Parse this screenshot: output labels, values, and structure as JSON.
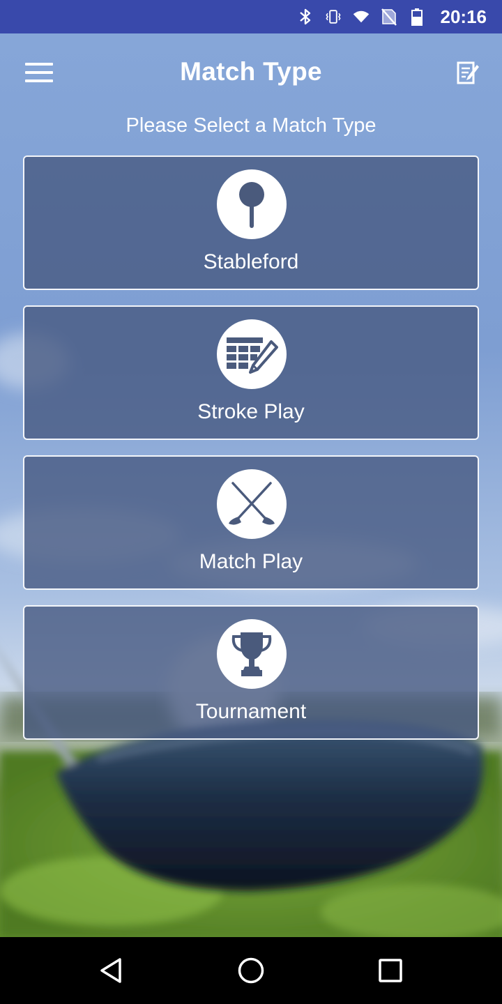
{
  "status_bar": {
    "time": "20:16",
    "icons": [
      "bluetooth-icon",
      "vibrate-icon",
      "wifi-icon",
      "no-sim-icon",
      "battery-icon"
    ]
  },
  "toolbar": {
    "menu_icon": "hamburger-menu-icon",
    "title": "Match Type",
    "action_icon": "notes-edit-icon"
  },
  "subtitle": "Please Select a Match Type",
  "match_types": [
    {
      "label": "Stableford",
      "icon": "golf-tee-icon"
    },
    {
      "label": "Stroke Play",
      "icon": "scorecard-pencil-icon"
    },
    {
      "label": "Match Play",
      "icon": "crossed-clubs-icon"
    },
    {
      "label": "Tournament",
      "icon": "trophy-icon"
    }
  ],
  "nav_bar": {
    "icons": [
      "back-icon",
      "home-icon",
      "recents-icon"
    ]
  },
  "colors": {
    "status_bar": "#3949ab",
    "card_fill": "#465880",
    "icon_fill": "#4a5a7c",
    "text": "#ffffff"
  }
}
